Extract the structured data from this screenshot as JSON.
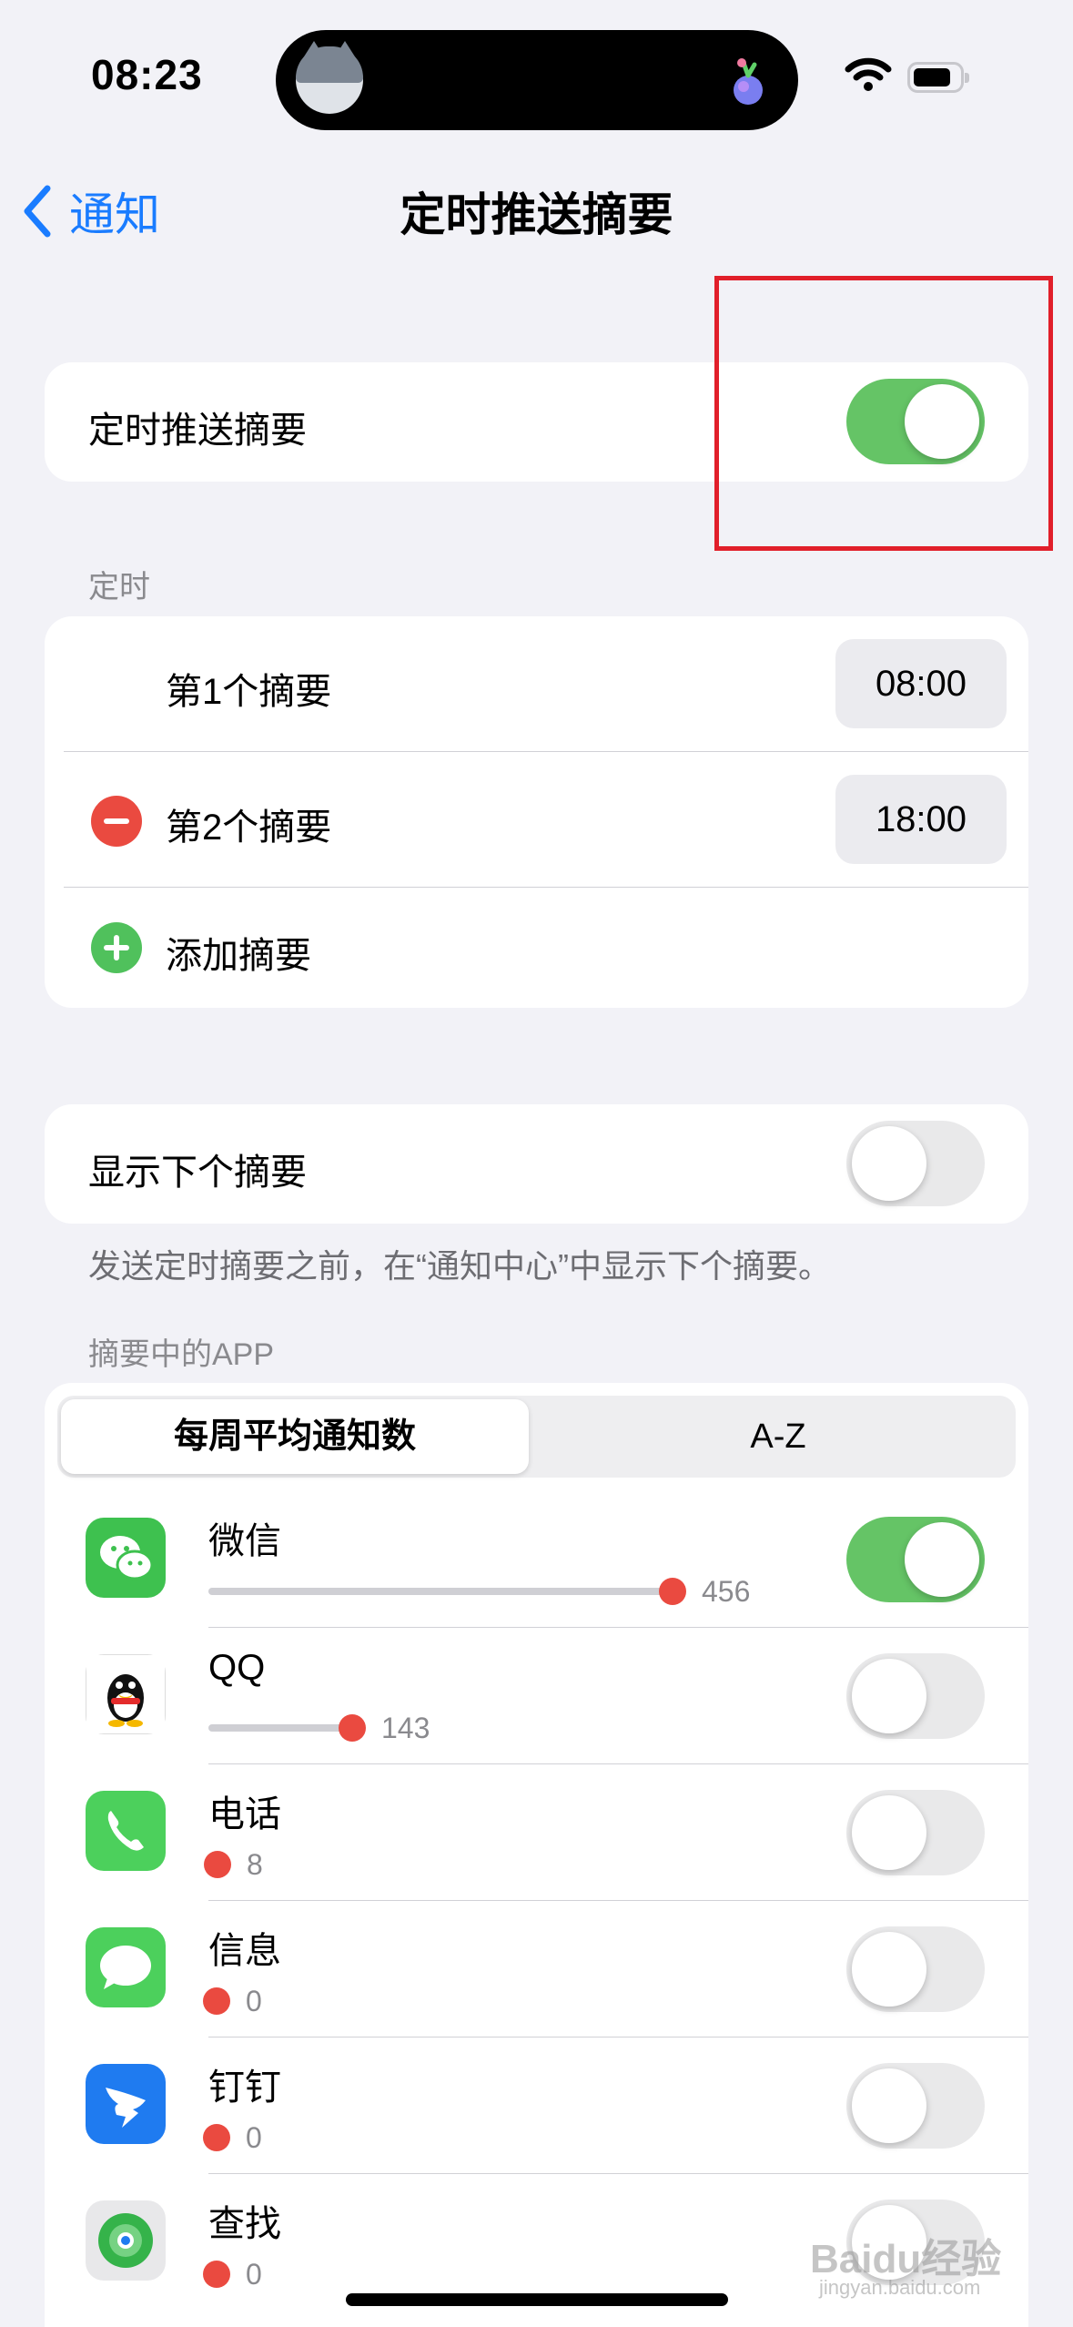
{
  "status_bar": {
    "time": "08:23"
  },
  "nav": {
    "back_label": "通知",
    "title": "定时推送摘要"
  },
  "main_toggle": {
    "label": "定时推送摘要",
    "on": true
  },
  "schedule": {
    "header": "定时",
    "items": [
      {
        "label": "第1个摘要",
        "time": "08:00",
        "removable": false
      },
      {
        "label": "第2个摘要",
        "time": "18:00",
        "removable": true
      }
    ],
    "add_label": "添加摘要"
  },
  "next_summary": {
    "label": "显示下个摘要",
    "on": false,
    "footnote": "发送定时摘要之前，在“通知中心”中显示下个摘要。"
  },
  "apps_section": {
    "header": "摘要中的APP",
    "segments": [
      "每周平均通知数",
      "A-Z"
    ],
    "active_segment": 0,
    "apps": [
      {
        "name": "微信",
        "count": "456",
        "fraction": 1.0,
        "on": true,
        "icon": "wechat-icon"
      },
      {
        "name": "QQ",
        "count": "143",
        "fraction": 0.31,
        "on": false,
        "icon": "qq-icon"
      },
      {
        "name": "电话",
        "count": "8",
        "fraction": 0.02,
        "on": false,
        "icon": "phone-icon"
      },
      {
        "name": "信息",
        "count": "0",
        "fraction": 0.0,
        "on": false,
        "icon": "messages-icon"
      },
      {
        "name": "钉钉",
        "count": "0",
        "fraction": 0.0,
        "on": false,
        "icon": "dingtalk-icon"
      },
      {
        "name": "查找",
        "count": "0",
        "fraction": 0.0,
        "on": false,
        "icon": "findmy-icon"
      }
    ]
  },
  "watermark": {
    "main": "Baidu经验",
    "sub": "jingyan.baidu.com"
  },
  "colors": {
    "accent": "#1a7cff",
    "toggle_on": "#65c466",
    "annotation": "#e11f2a",
    "count_dot": "#ea4a40"
  }
}
